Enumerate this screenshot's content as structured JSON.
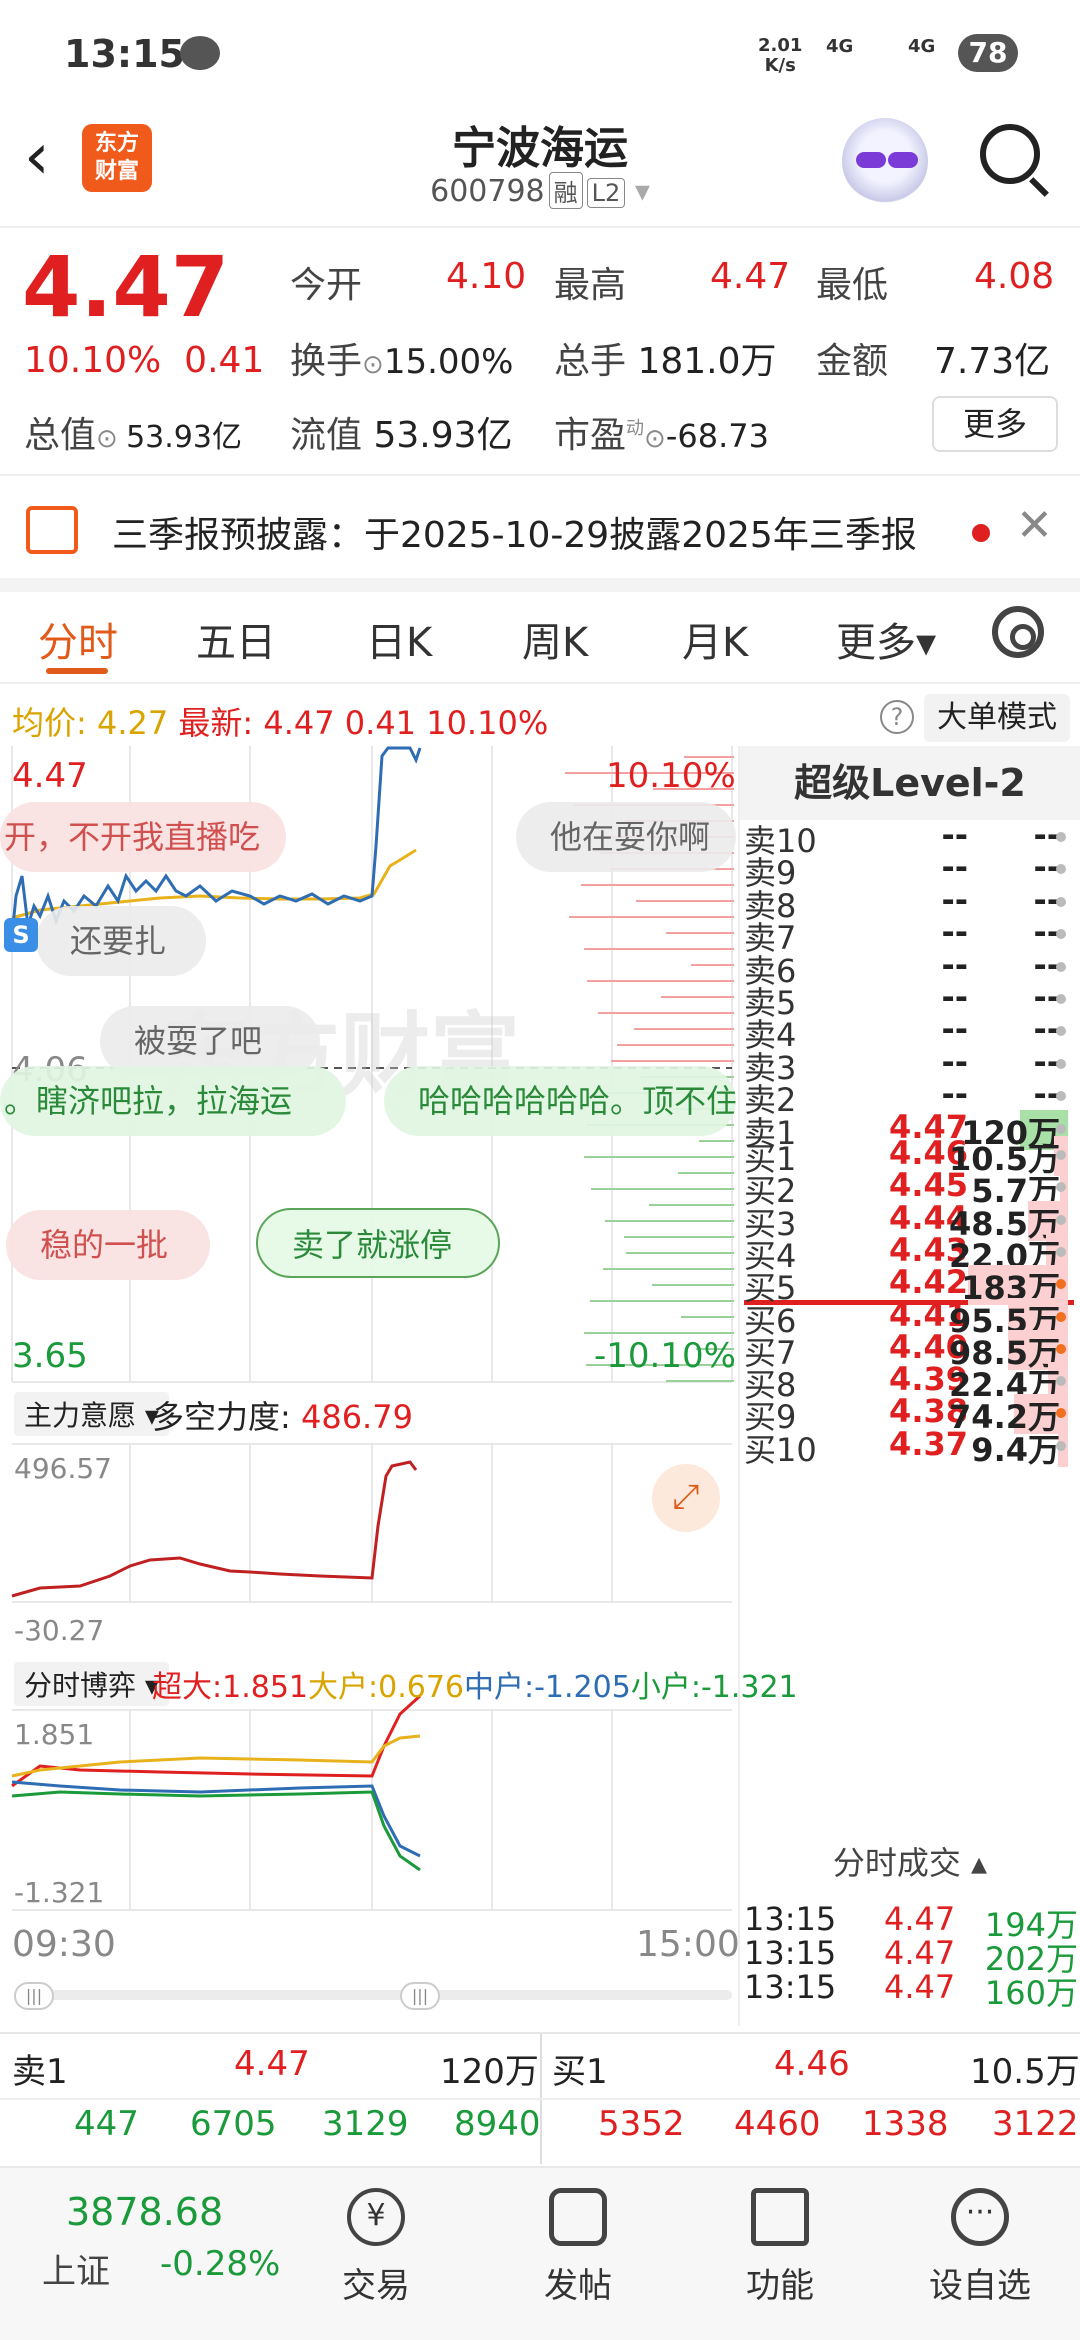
{
  "status_bar": {
    "time": "13:15",
    "net_rate": "2.01",
    "net_unit": "K/s",
    "sig1": "4G",
    "sig2": "4G",
    "battery": "78"
  },
  "header": {
    "name": "宁波海运",
    "code": "600798",
    "tag1": "融",
    "tag2": "L2",
    "logo_top": "东方",
    "logo_bottom": "财富"
  },
  "quote": {
    "price": "4.47",
    "change_pct": "10.10%",
    "change_amt": "0.41",
    "open_label": "今开",
    "open": "4.10",
    "high_label": "最高",
    "high": "4.47",
    "low_label": "最低",
    "low": "4.08",
    "turnover_label": "换手",
    "turnover": "15.00%",
    "volume_label": "总手",
    "volume": "181.0万",
    "amount_label": "金额",
    "amount": "7.73亿",
    "mktcap_label": "总值",
    "mktcap": "53.93亿",
    "float_label": "流值",
    "float": "53.93亿",
    "pe_label": "市盈",
    "pe_sup": "动",
    "pe": "-68.73",
    "more": "更多"
  },
  "notice": {
    "text": "三季报预披露：于2025-10-29披露2025年三季报"
  },
  "tabs": [
    "分时",
    "五日",
    "日K",
    "周K",
    "月K",
    "更多▾"
  ],
  "avg_bar": {
    "avg_label": "均价:",
    "avg": "4.27",
    "latest_label": "最新:",
    "latest": "4.47",
    "amt": "0.41",
    "pct": "10.10%",
    "help": "?",
    "big_mode": "大单模式"
  },
  "chart": {
    "high_price": "4.47",
    "high_pct": "10.10%",
    "mid_price": "4.06",
    "low_price": "3.65",
    "low_pct": "-10.10%",
    "ind1_select": "主力意愿 ▾",
    "ind1_label": "多空力度:",
    "ind1_value": "486.79",
    "ind1_max": "496.57",
    "ind1_min": "-30.27",
    "ind2_select": "分时博弈 ▾",
    "ind2_items": [
      {
        "label": "超大:",
        "value": "1.851",
        "color": "#e02020"
      },
      {
        "label": "大户:",
        "value": "0.676",
        "color": "#d9a400"
      },
      {
        "label": "中户:",
        "value": "-1.205",
        "color": "#2e6db4"
      },
      {
        "label": "小户:",
        "value": "-1.321",
        "color": "#1a9a3a"
      }
    ],
    "ind2_max": "1.851",
    "ind2_min": "-1.321",
    "time_start": "09:30",
    "time_end": "15:00",
    "bubbles": [
      "开，不开我直播吃",
      "他在耍你啊",
      "还要扎",
      "被耍了吧",
      "。瞎济吧拉，拉海运",
      "哈哈哈哈哈哈。顶不住",
      "稳的一批",
      "卖了就涨停"
    ],
    "watermark": "东方财富",
    "colors": {
      "price": "#2e6db4",
      "avg": "#e8b21c",
      "up": "#e02020",
      "down": "#1a9a3a"
    }
  },
  "orderbook": {
    "title": "超级Level-2",
    "asks": [
      {
        "label": "卖10",
        "price": "--",
        "vol": "--"
      },
      {
        "label": "卖9",
        "price": "--",
        "vol": "--"
      },
      {
        "label": "卖8",
        "price": "--",
        "vol": "--"
      },
      {
        "label": "卖7",
        "price": "--",
        "vol": "--"
      },
      {
        "label": "卖6",
        "price": "--",
        "vol": "--"
      },
      {
        "label": "卖5",
        "price": "--",
        "vol": "--"
      },
      {
        "label": "卖4",
        "price": "--",
        "vol": "--"
      },
      {
        "label": "卖3",
        "price": "--",
        "vol": "--"
      },
      {
        "label": "卖2",
        "price": "--",
        "vol": "--"
      },
      {
        "label": "卖1",
        "price": "4.47",
        "vol": "120万"
      }
    ],
    "bids": [
      {
        "label": "买1",
        "price": "4.46",
        "vol": "10.5万"
      },
      {
        "label": "买2",
        "price": "4.45",
        "vol": "5.7万"
      },
      {
        "label": "买3",
        "price": "4.44",
        "vol": "48.5万"
      },
      {
        "label": "买4",
        "price": "4.43",
        "vol": "22.0万"
      },
      {
        "label": "买5",
        "price": "4.42",
        "vol": "183万"
      },
      {
        "label": "买6",
        "price": "4.41",
        "vol": "95.5万"
      },
      {
        "label": "买7",
        "price": "4.40",
        "vol": "98.5万"
      },
      {
        "label": "买8",
        "price": "4.39",
        "vol": "22.4万"
      },
      {
        "label": "买9",
        "price": "4.38",
        "vol": "74.2万"
      },
      {
        "label": "买10",
        "price": "4.37",
        "vol": "9.4万"
      }
    ],
    "trades_title": "分时成交 ▴",
    "trades": [
      {
        "time": "13:15",
        "price": "4.47",
        "vol": "194万"
      },
      {
        "time": "13:15",
        "price": "4.47",
        "vol": "202万"
      },
      {
        "time": "13:15",
        "price": "4.47",
        "vol": "160万"
      }
    ]
  },
  "summary": {
    "left_label": "卖1",
    "left_price": "4.47",
    "left_vol": "120万",
    "right_label": "买1",
    "right_price": "4.46",
    "right_vol": "10.5万",
    "left_nums": [
      "447",
      "6705",
      "3129",
      "8940"
    ],
    "right_nums": [
      "5352",
      "4460",
      "1338",
      "3122"
    ]
  },
  "bottom_nav": {
    "index_value": "3878.68",
    "index_name": "上证",
    "index_change": "-0.28%",
    "items": [
      "交易",
      "发帖",
      "功能",
      "设自选"
    ]
  }
}
